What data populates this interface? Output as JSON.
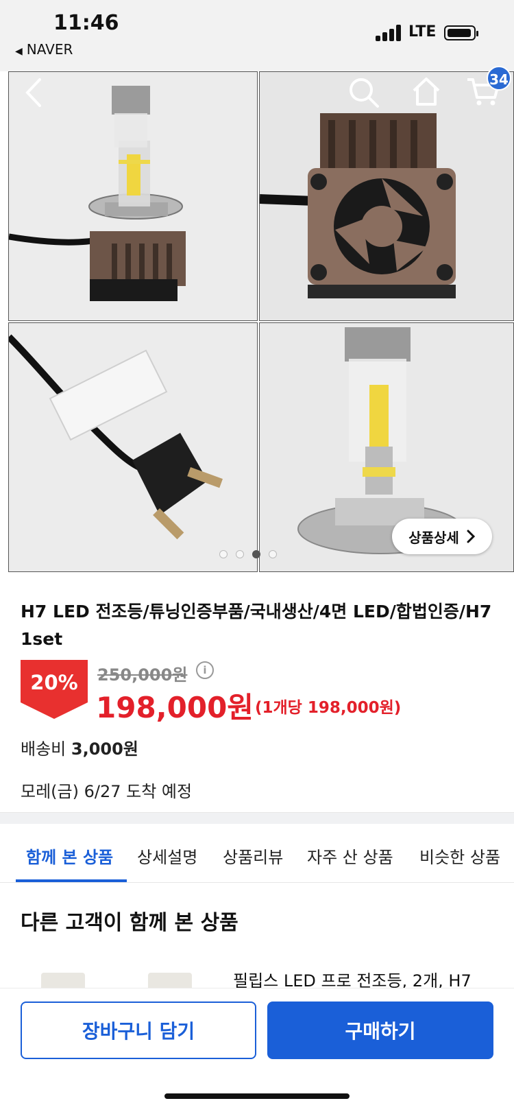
{
  "status_bar": {
    "time": "11:46",
    "back_app": "NAVER",
    "network": "LTE"
  },
  "nav": {
    "cart_count": "34"
  },
  "gallery": {
    "image_count": 4,
    "active_index": 2,
    "detail_button": "상품상세"
  },
  "product": {
    "title": "H7 LED 전조등/튜닝인증부품/국내생산/4면 LED/합법인증/H7 1set",
    "discount": "20%",
    "original_price": "250,000원",
    "sale_price": "198,000원",
    "per_unit": "(1개당 198,000원)",
    "shipping_label": "배송비",
    "shipping_value": "3,000원",
    "arrival": "모레(금) 6/27 도착 예정"
  },
  "tabs": [
    {
      "label": "함께 본 상품",
      "active": true
    },
    {
      "label": "상세설명"
    },
    {
      "label": "상품리뷰"
    },
    {
      "label": "자주 산 상품"
    },
    {
      "label": "비슷한 상품"
    }
  ],
  "recommend": {
    "title": "다른 고객이 함께 본 상품",
    "first_item": "필립스 LED 프로 전조등, 2개, H7"
  },
  "actions": {
    "cart": "장바구니 담기",
    "buy": "구매하기"
  },
  "colors": {
    "accent": "#1a5fd8",
    "sale": "#e3202a",
    "badge": "#2a6ad3"
  },
  "icons": [
    "back-icon",
    "search-icon",
    "home-icon",
    "cart-icon",
    "info-icon",
    "chevron-right-icon"
  ]
}
